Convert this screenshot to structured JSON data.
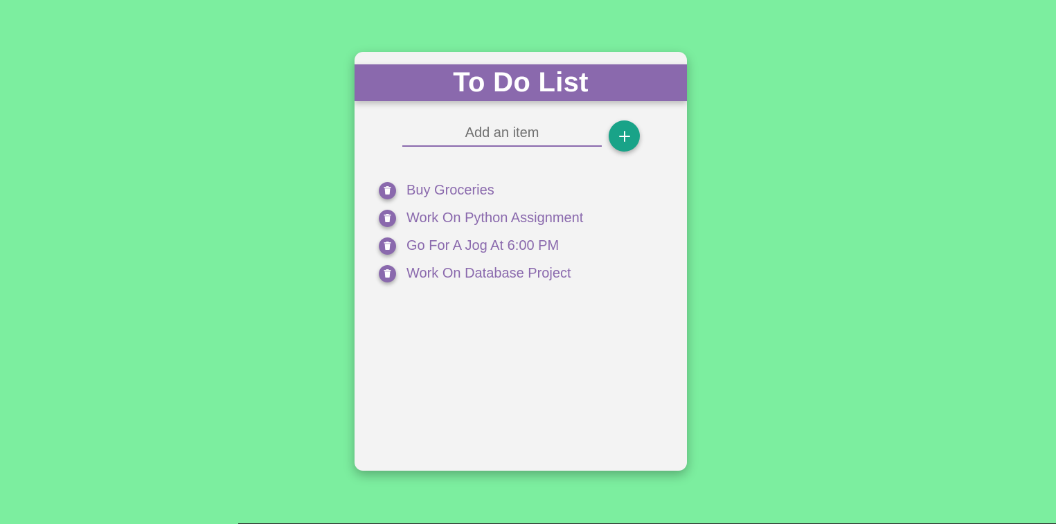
{
  "app": {
    "title": "To Do List"
  },
  "form": {
    "placeholder": "Add an item",
    "value": "",
    "add_icon": "plus-icon"
  },
  "items": [
    {
      "label": "Buy Groceries",
      "icon": "trash-icon"
    },
    {
      "label": "Work On Python Assignment",
      "icon": "trash-icon"
    },
    {
      "label": "Go For A Jog At 6:00 PM",
      "icon": "trash-icon"
    },
    {
      "label": "Work On Database Project",
      "icon": "trash-icon"
    }
  ],
  "colors": {
    "background": "#7cee9f",
    "card": "#f3f3f3",
    "accent": "#8a69ad",
    "add_button": "#19a388"
  }
}
